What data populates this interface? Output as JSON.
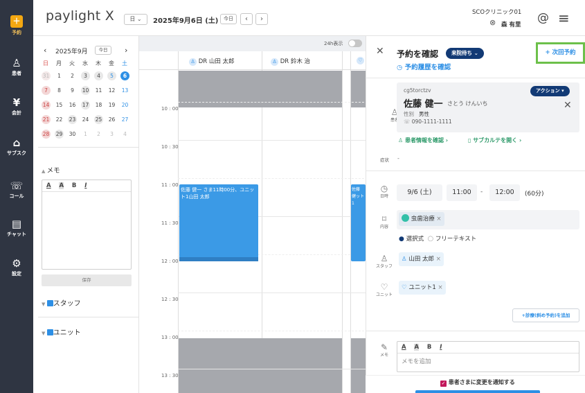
{
  "nav": {
    "items": [
      {
        "label": "予約"
      },
      {
        "label": "患者"
      },
      {
        "label": "会計"
      },
      {
        "label": "サブスク"
      },
      {
        "label": "コール"
      },
      {
        "label": "チャット"
      },
      {
        "label": "設定"
      }
    ]
  },
  "header": {
    "logo": "paylight X",
    "view_select": "日",
    "date": "2025年9月6日 (土)",
    "today": "今日",
    "clinic": "SCOクリニック01",
    "user": "森 有里"
  },
  "calendar": {
    "month": "2025年9月",
    "today": "今日",
    "weekdays": [
      "日",
      "月",
      "火",
      "水",
      "木",
      "金",
      "土"
    ],
    "days": [
      "31",
      "1",
      "2",
      "3",
      "4",
      "5",
      "6",
      "7",
      "8",
      "9",
      "10",
      "11",
      "12",
      "13",
      "14",
      "15",
      "16",
      "17",
      "18",
      "19",
      "20",
      "21",
      "22",
      "23",
      "24",
      "25",
      "26",
      "27",
      "28",
      "29",
      "30",
      "1",
      "2",
      "3",
      "4"
    ]
  },
  "memo": {
    "title": "メモ",
    "tools": [
      "A",
      "A",
      "B",
      "I"
    ],
    "save": "保存"
  },
  "filters": {
    "staff": "スタッフ",
    "unit": "ユニット"
  },
  "schedule": {
    "toggle": "24h表示",
    "columns": [
      "DR 山田 太郎",
      "DR 鈴木 治"
    ],
    "times": [
      "10 : 00",
      "10 : 30",
      "11 : 00",
      "11 : 30",
      "12 : 00",
      "12 : 30",
      "13 : 00",
      "13 : 30"
    ],
    "event": "佐藤 健一 さま11時00分、ユニット1山田 太郎",
    "event_partial": "佐藤 健ット1"
  },
  "detail": {
    "title": "予約を確認",
    "status": "来院待ち",
    "history": "予約履歴を確認",
    "next": "+ 次回予約",
    "patient_label": "患者",
    "patient_id": "cg5torctzv",
    "action": "アクション",
    "name": "佐藤 健一",
    "kana": "さとう けんいち",
    "gender_label": "性別",
    "gender": "男性",
    "phone": "090-1111-1111",
    "info_link": "患者情報を確認",
    "karte_link": "サブカルテを開く",
    "symptom_label": "症状",
    "symptom": "-",
    "date_label": "日時",
    "date": "9/6 (土)",
    "start": "11:00",
    "dash": "-",
    "end": "12:00",
    "duration": "(60分)",
    "content_label": "内容",
    "treatment": "虫歯治療",
    "mode1": "選択式",
    "mode2": "フリーテキスト",
    "staff_label": "スタッフ",
    "staff": "山田 太郎",
    "unit_label": "ユニット",
    "unit": "ユニット1",
    "add_button": "+診療(斜め予約)を追加",
    "memo_label": "メモ",
    "memo_placeholder": "メモを追加",
    "notify": "患者さまに変更を通知する"
  },
  "colors": {
    "accent": "#2d8fe5",
    "nav": "#2f3542",
    "status": "#123a75",
    "highlight": "#6cc04a",
    "event": "#3b9ae6"
  }
}
